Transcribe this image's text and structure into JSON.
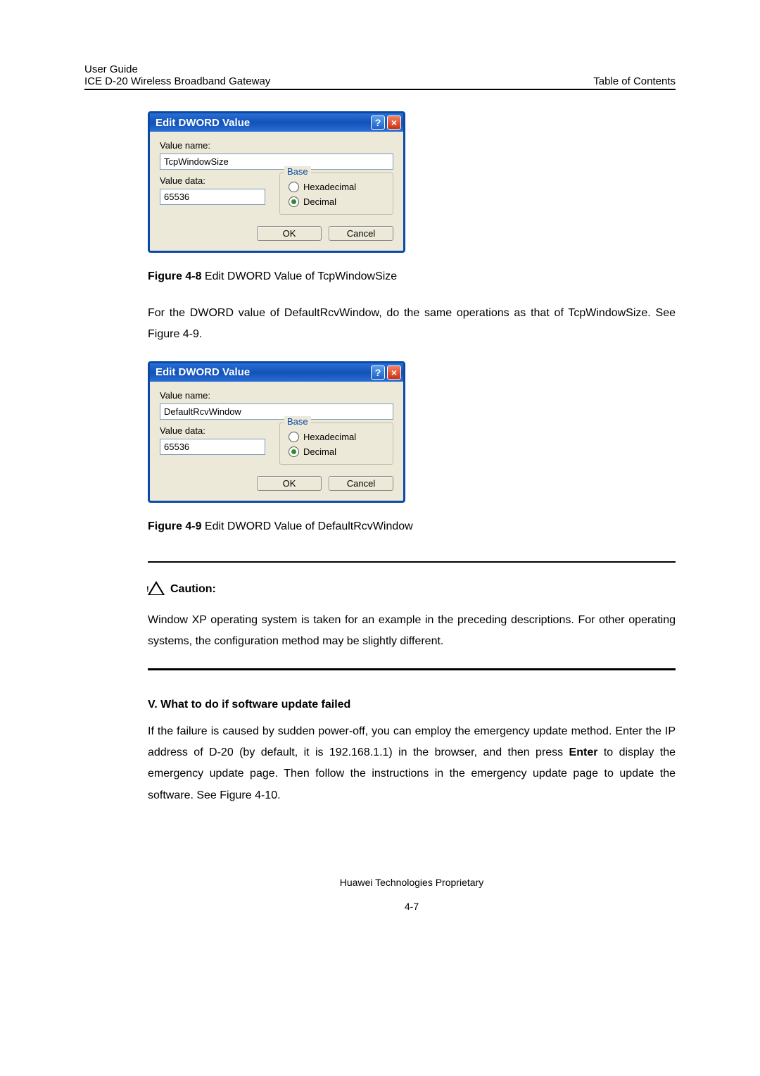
{
  "header": {
    "left_line1": "User Guide",
    "left_line2": "ICE D-20 Wireless Broadband Gateway",
    "right": "Table of Contents"
  },
  "dialog1": {
    "title": "Edit DWORD Value",
    "value_name_label": "Value name:",
    "value_name": "TcpWindowSize",
    "value_data_label": "Value data:",
    "value_data": "65536",
    "base_label": "Base",
    "hex_label": "Hexadecimal",
    "dec_label": "Decimal",
    "ok": "OK",
    "cancel": "Cancel"
  },
  "fig1": {
    "prefix": "Figure 4-8",
    "text": " Edit DWORD Value of TcpWindowSize"
  },
  "para1": "For the DWORD value of DefaultRcvWindow, do the same operations as that of TcpWindowSize. See Figure 4-9.",
  "dialog2": {
    "title": "Edit DWORD Value",
    "value_name_label": "Value name:",
    "value_name": "DefaultRcvWindow",
    "value_data_label": "Value data:",
    "value_data": "65536",
    "base_label": "Base",
    "hex_label": "Hexadecimal",
    "dec_label": "Decimal",
    "ok": "OK",
    "cancel": "Cancel"
  },
  "fig2": {
    "prefix": "Figure 4-9",
    "text": " Edit DWORD Value of DefaultRcvWindow"
  },
  "caution": {
    "label": "Caution:",
    "text": "Window XP operating system is taken for an example in the preceding descriptions. For other operating systems, the configuration method may be slightly different."
  },
  "section5": {
    "heading": "V. What to do if software update failed",
    "p1a": "If the failure is caused by sudden power-off, you can employ the emergency update method. Enter the IP address of D-20 (by default, it is 192.168.1.1) in the browser, and then press ",
    "enter": "Enter",
    "p1b": " to display the emergency update page. Then follow the instructions in the emergency update page to update the software. See Figure 4-10."
  },
  "footer": {
    "line1": "Huawei Technologies Proprietary",
    "line2": "4-7"
  }
}
